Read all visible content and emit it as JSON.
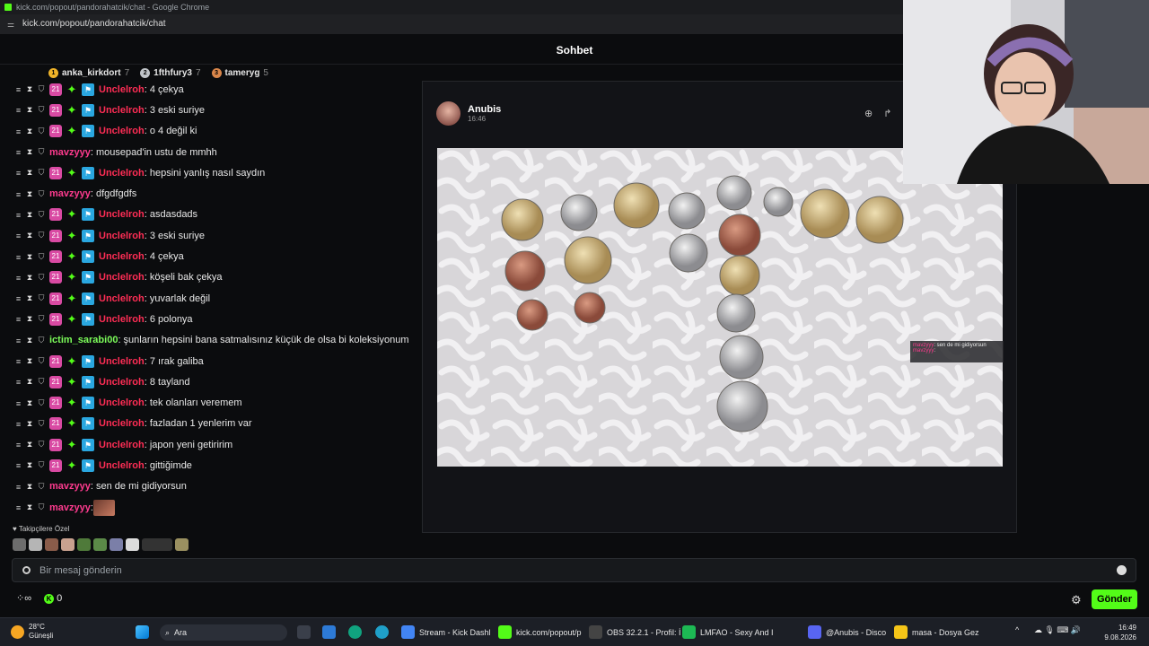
{
  "window": {
    "title": "kick.com/popout/pandorahatcik/chat - Google Chrome",
    "url": "kick.com/popout/pandorahatcik/chat"
  },
  "header": {
    "title": "Sohbet"
  },
  "leaderboard": [
    {
      "name": "anka_kirkdort",
      "count": "7",
      "color": "#f0b429",
      "rank": "1"
    },
    {
      "name": "1fthfury3",
      "count": "7",
      "color": "#c0c4c8",
      "rank": "2"
    },
    {
      "name": "tameryg",
      "count": "5",
      "color": "#d9864a",
      "rank": "3"
    }
  ],
  "messages": [
    {
      "user": "Unclelroh",
      "text": ": 4 çekya",
      "color": "#ff2d55",
      "sub": true,
      "sub_months": "21"
    },
    {
      "user": "Unclelroh",
      "text": ": 3 eski suriye",
      "color": "#ff2d55",
      "sub": true,
      "sub_months": "21"
    },
    {
      "user": "Unclelroh",
      "text": ": o 4 değil ki",
      "color": "#ff2d55",
      "sub": true,
      "sub_months": "21"
    },
    {
      "user": "mavzyyy",
      "text": ": mousepad'in ustu de mmhh",
      "color": "#ff3b8f",
      "sub": false
    },
    {
      "user": "Unclelroh",
      "text": ": hepsini yanlış nasıl saydın",
      "color": "#ff2d55",
      "sub": true,
      "sub_months": "21"
    },
    {
      "user": "mavzyyy",
      "text": ": dfgdfgdfs",
      "color": "#ff3b8f",
      "sub": false
    },
    {
      "user": "Unclelroh",
      "text": ": asdasdads",
      "color": "#ff2d55",
      "sub": true,
      "sub_months": "21"
    },
    {
      "user": "Unclelroh",
      "text": ": 3 eski suriye",
      "color": "#ff2d55",
      "sub": true,
      "sub_months": "21"
    },
    {
      "user": "Unclelroh",
      "text": ": 4 çekya",
      "color": "#ff2d55",
      "sub": true,
      "sub_months": "21"
    },
    {
      "user": "Unclelroh",
      "text": ": köşeli bak çekya",
      "color": "#ff2d55",
      "sub": true,
      "sub_months": "21"
    },
    {
      "user": "Unclelroh",
      "text": ": yuvarlak değil",
      "color": "#ff2d55",
      "sub": true,
      "sub_months": "21"
    },
    {
      "user": "Unclelroh",
      "text": ": 6 polonya",
      "color": "#ff2d55",
      "sub": true,
      "sub_months": "21"
    },
    {
      "user": "ictim_sarabi00",
      "text": ": şunların hepsini bana satmalısınız küçük de olsa bi koleksiyonum",
      "color": "#7cfc5a",
      "sub": false
    },
    {
      "user": "Unclelroh",
      "text": ": 7 ırak galiba",
      "color": "#ff2d55",
      "sub": true,
      "sub_months": "21"
    },
    {
      "user": "Unclelroh",
      "text": ": 8 tayland",
      "color": "#ff2d55",
      "sub": true,
      "sub_months": "21"
    },
    {
      "user": "Unclelroh",
      "text": ": tek olanları veremem",
      "color": "#ff2d55",
      "sub": true,
      "sub_months": "21"
    },
    {
      "user": "Unclelroh",
      "text": ": fazladan 1 yenlerim var",
      "color": "#ff2d55",
      "sub": true,
      "sub_months": "21"
    },
    {
      "user": "Unclelroh",
      "text": ": japon yeni getiririm",
      "color": "#ff2d55",
      "sub": true,
      "sub_months": "21"
    },
    {
      "user": "Unclelroh",
      "text": ": gittiğimde",
      "color": "#ff2d55",
      "sub": true,
      "sub_months": "21"
    },
    {
      "user": "mavzyyy",
      "text": ": sen de mi gidiyorsun",
      "color": "#ff3b8f",
      "sub": false
    },
    {
      "user": "mavzyyy",
      "text": ":",
      "color": "#ff3b8f",
      "sub": false,
      "image": true
    }
  ],
  "followers_label": "Takipçilere Özel",
  "input": {
    "placeholder": "Bir mesaj gönderin"
  },
  "bottom": {
    "kick_count": "0",
    "send_label": "Gönder"
  },
  "overlay": {
    "author": "Anubis",
    "time": "16:46",
    "mini_chat": [
      {
        "user": "mavzyyy",
        "text": ": sen de mi gidiyorsun"
      },
      {
        "user": "mavzyyy",
        "text": ":"
      }
    ]
  },
  "taskbar": {
    "weather_temp": "28°C",
    "weather_label": "Güneşli",
    "search_label": "Ara",
    "apps": [
      {
        "label": "Stream - Kick Dashl",
        "color": "#4285f4"
      },
      {
        "label": "kick.com/popout/p",
        "color": "#53fc18"
      },
      {
        "label": "OBS 32.2.1 - Profil: İ",
        "color": "#444"
      },
      {
        "label": "LMFAO - Sexy And I",
        "color": "#1db954"
      },
      {
        "label": "@Anubis - Disco",
        "color": "#5865f2"
      },
      {
        "label": "masa - Dosya Gez",
        "color": "#f5c518"
      }
    ],
    "time": "16:49",
    "date": "9.08.2026"
  }
}
